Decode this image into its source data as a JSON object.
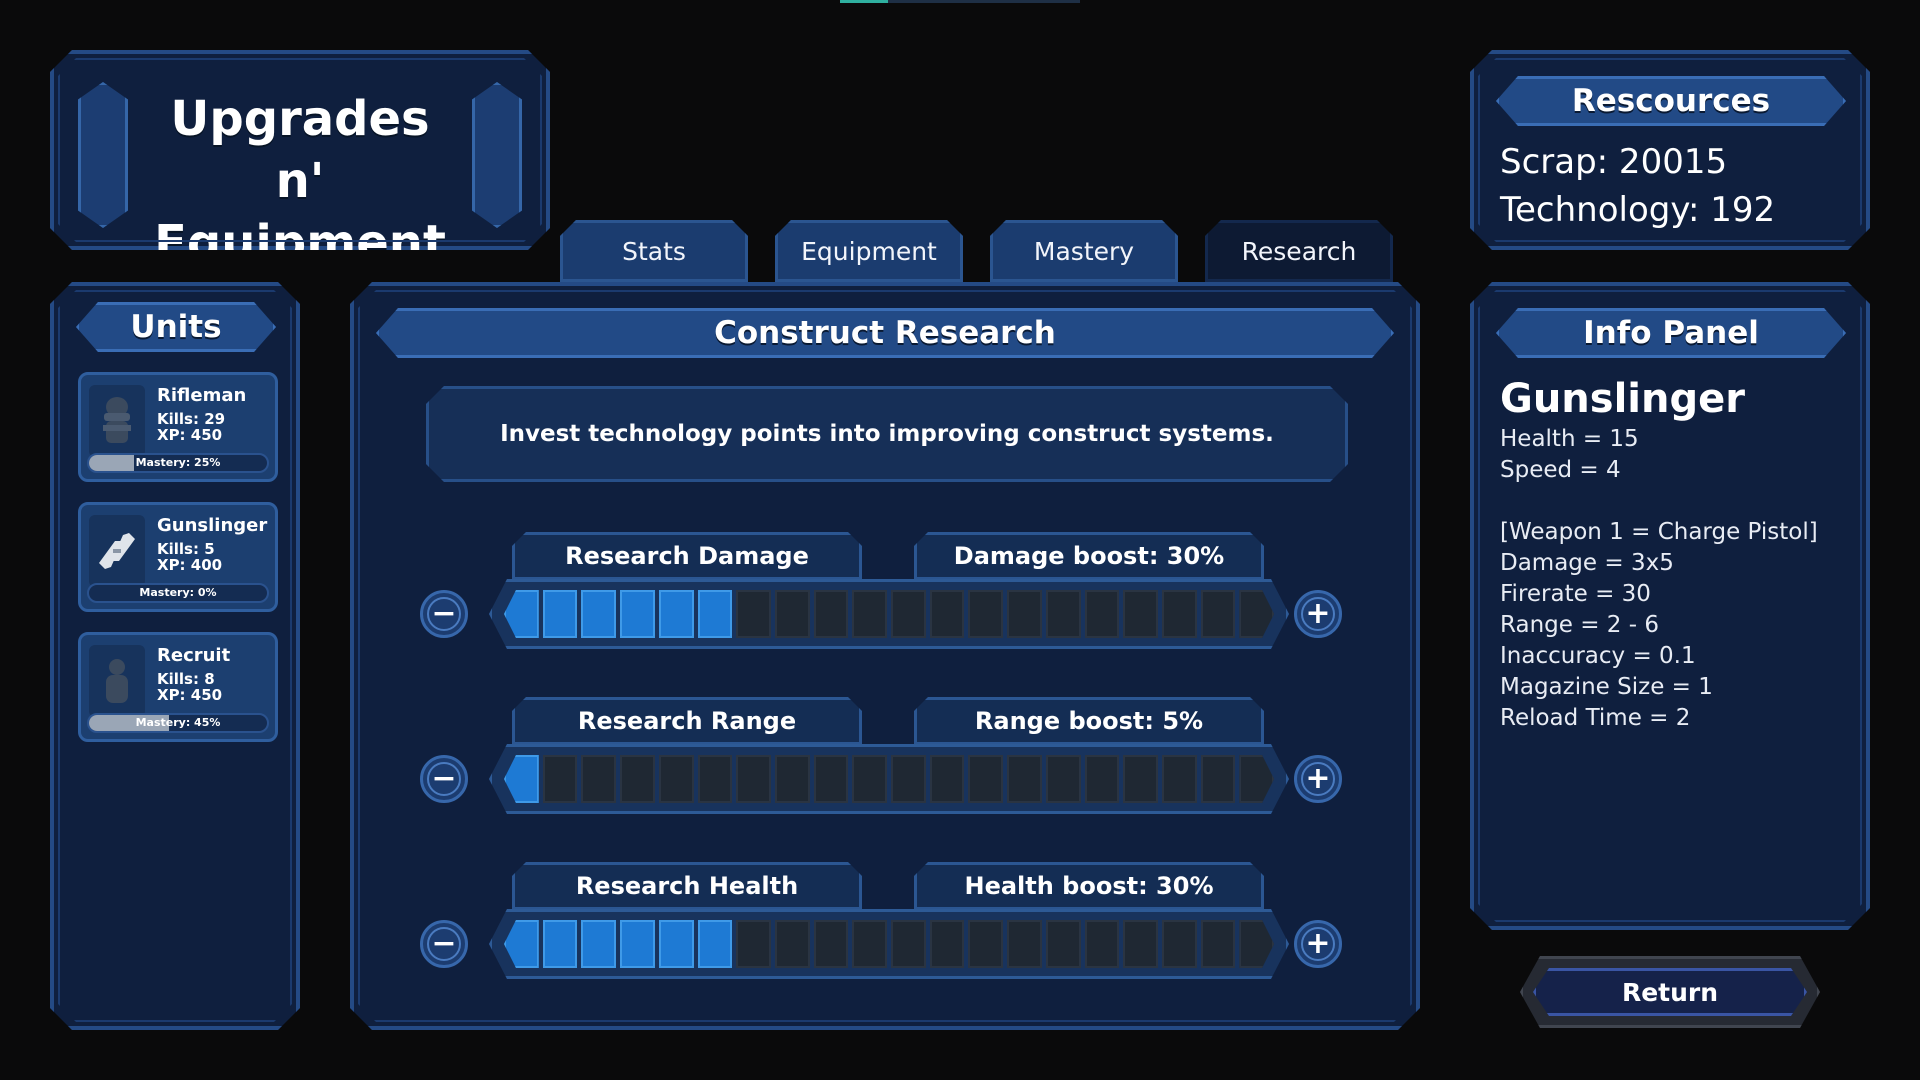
{
  "title": "Upgrades n'\nEquipment",
  "tabs": [
    {
      "label": "Stats",
      "active": false
    },
    {
      "label": "Equipment",
      "active": false
    },
    {
      "label": "Mastery",
      "active": false
    },
    {
      "label": "Research",
      "active": true
    }
  ],
  "units": {
    "header": "Units",
    "items": [
      {
        "name": "Rifleman",
        "kills": "Kills: 29",
        "xp": "XP: 450",
        "mastery_label": "Mastery: 25%",
        "mastery": 0.25,
        "icon": "soldier-icon"
      },
      {
        "name": "Gunslinger",
        "kills": "Kills: 5",
        "xp": "XP: 400",
        "mastery_label": "Mastery: 0%",
        "mastery": 0.0,
        "icon": "pistols-icon"
      },
      {
        "name": "Recruit",
        "kills": "Kills: 8",
        "xp": "XP: 450",
        "mastery_label": "Mastery: 45%",
        "mastery": 0.45,
        "icon": "recruit-icon"
      }
    ]
  },
  "research": {
    "header": "Construct Research",
    "description": "Invest technology points into improving construct systems.",
    "rows": [
      {
        "label": "Research Damage",
        "boost": "Damage boost: 30%",
        "filled": 6,
        "total": 20
      },
      {
        "label": "Research Range",
        "boost": "Range boost: 5%",
        "filled": 1,
        "total": 20
      },
      {
        "label": "Research Health",
        "boost": "Health boost: 30%",
        "filled": 6,
        "total": 20
      }
    ],
    "minus_symbol": "−",
    "plus_symbol": "+"
  },
  "resources": {
    "header": "Rescources",
    "scrap": "Scrap: 20015",
    "technology": "Technology: 192"
  },
  "info": {
    "header": "Info Panel",
    "title": "Gunslinger",
    "lines": [
      "Health = 15",
      "Speed = 4",
      "",
      "[Weapon 1 = Charge Pistol]",
      "Damage = 3x5",
      "Firerate = 30",
      "Range = 2 - 6",
      "Inaccuracy = 0.1",
      "Magazine Size = 1",
      "Reload Time = 2"
    ]
  },
  "return_label": "Return",
  "colors": {
    "background": "#0a0a0b",
    "panel": "#0f1f3e",
    "accent": "#1e7ad4",
    "empty_segment": "#1f2833"
  }
}
